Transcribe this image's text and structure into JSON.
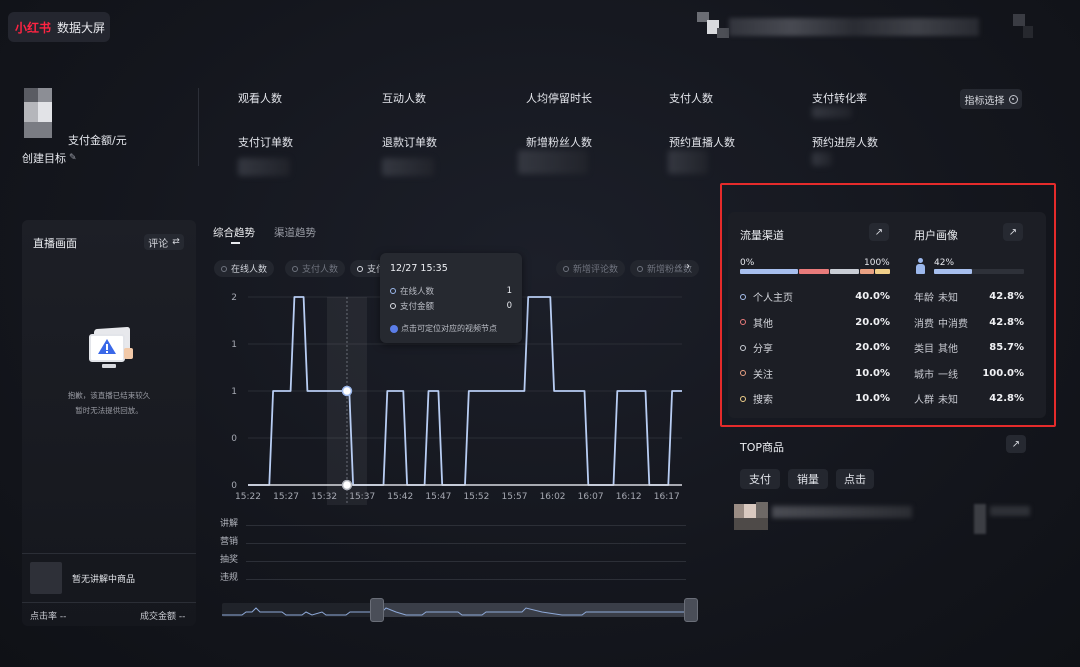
{
  "header": {
    "brand": "小红书",
    "title": "数据大屏"
  },
  "target": {
    "label": "支付金额/元",
    "create_label": "创建目标",
    "edit_icon": "pencil-icon"
  },
  "metrics": {
    "row1": [
      "观看人数",
      "互动人数",
      "人均停留时长",
      "支付人数",
      "支付转化率"
    ],
    "row2": [
      "支付订单数",
      "退款订单数",
      "新增粉丝人数",
      "预约直播人数",
      "预约进房人数"
    ],
    "select_button": "指标选择"
  },
  "live": {
    "title": "直播画面",
    "comment_button": "评论",
    "empty_line1": "抱歉，该直播已结束较久",
    "empty_line2": "暂时无法提供回放。",
    "product_label": "暂无讲解中商品",
    "click_rate_label": "点击率 --",
    "deal_amount_label": "成交金额 --"
  },
  "trend": {
    "tabs": [
      "综合趋势",
      "渠道趋势"
    ],
    "active_tab": 0,
    "legend": [
      {
        "label": "在线人数",
        "active": true,
        "color": "#9cb8ec"
      },
      {
        "label": "支付人数",
        "active": false,
        "color": "#6f737e"
      },
      {
        "label": "支付金额",
        "active": true,
        "color": "#d9dbe2"
      },
      {
        "label": "新增评论数",
        "active": false,
        "color": "#6f737e"
      },
      {
        "label": "新增粉丝数",
        "active": false,
        "color": "#6f737e"
      }
    ],
    "tooltip": {
      "time": "12/27 15:35",
      "rows": [
        {
          "label": "在线人数",
          "value": "1"
        },
        {
          "label": "支付金额",
          "value": "0"
        }
      ],
      "hint": "点击可定位对应的视频节点"
    },
    "lanes": [
      "讲解",
      "营销",
      "抽奖",
      "违规"
    ]
  },
  "chart_data": {
    "type": "line",
    "ylabels": [
      "0",
      "0",
      "1",
      "1",
      "2"
    ],
    "x_ticks": [
      "15:22",
      "15:27",
      "15:32",
      "15:37",
      "15:42",
      "15:47",
      "15:52",
      "15:57",
      "16:02",
      "16:07",
      "16:12",
      "16:17"
    ],
    "x_range_minutes": [
      0,
      57
    ],
    "ylim": [
      0,
      2
    ],
    "series": [
      {
        "name": "在线人数",
        "color": "#b8cdf3",
        "points": [
          [
            0,
            0
          ],
          [
            2.8,
            0
          ],
          [
            3.3,
            1
          ],
          [
            5.6,
            1
          ],
          [
            6.1,
            2
          ],
          [
            7.3,
            2
          ],
          [
            7.8,
            1
          ],
          [
            13.3,
            1
          ],
          [
            13.8,
            0
          ],
          [
            17.8,
            0
          ],
          [
            18.3,
            1
          ],
          [
            20.4,
            1
          ],
          [
            20.9,
            0
          ],
          [
            23.2,
            0
          ],
          [
            23.7,
            1
          ],
          [
            25.0,
            1
          ],
          [
            25.5,
            0
          ],
          [
            28.5,
            0
          ],
          [
            29.0,
            1
          ],
          [
            36.3,
            1
          ],
          [
            36.8,
            2
          ],
          [
            39.7,
            2
          ],
          [
            40.2,
            1
          ],
          [
            44.2,
            1
          ],
          [
            44.7,
            0
          ],
          [
            48.0,
            0
          ],
          [
            48.5,
            1
          ],
          [
            52.2,
            1
          ],
          [
            52.7,
            0
          ],
          [
            55.2,
            0
          ],
          [
            55.7,
            1
          ],
          [
            57,
            1
          ]
        ]
      },
      {
        "name": "支付金额",
        "color": "#d9dbe2",
        "points": [
          [
            0,
            0
          ],
          [
            57,
            0
          ]
        ]
      }
    ],
    "cursor_minute": 13.0
  },
  "traffic": {
    "title": "流量渠道",
    "scale_min": "0%",
    "scale_max": "100%",
    "bar_segments": [
      {
        "fraction": 0.4,
        "color": "#a7bfee"
      },
      {
        "fraction": 0.2,
        "color": "#e97b7b"
      },
      {
        "fraction": 0.2,
        "color": "#c9cdd5"
      },
      {
        "fraction": 0.1,
        "color": "#e9a183"
      },
      {
        "fraction": 0.1,
        "color": "#f1d08a"
      }
    ],
    "rows": [
      {
        "label": "个人主页",
        "value": "40.0%",
        "color": "#a7bfee"
      },
      {
        "label": "其他",
        "value": "20.0%",
        "color": "#e97b7b"
      },
      {
        "label": "分享",
        "value": "20.0%",
        "color": "#c9cdd5"
      },
      {
        "label": "关注",
        "value": "10.0%",
        "color": "#e9a183"
      },
      {
        "label": "搜索",
        "value": "10.0%",
        "color": "#f1d08a"
      }
    ]
  },
  "persona": {
    "title": "用户画像",
    "gender_value": "42%",
    "gender_fraction": 0.42,
    "rows": [
      {
        "key": "年龄",
        "value": "未知",
        "pct": "42.8%"
      },
      {
        "key": "消费",
        "value": "中消费",
        "pct": "42.8%"
      },
      {
        "key": "类目",
        "value": "其他",
        "pct": "85.7%"
      },
      {
        "key": "城市",
        "value": "一线",
        "pct": "100.0%"
      },
      {
        "key": "人群",
        "value": "未知",
        "pct": "42.8%"
      }
    ]
  },
  "top_products": {
    "title": "TOP商品",
    "chips": [
      "支付",
      "销量",
      "点击"
    ]
  },
  "icons": {
    "expand": "external-arrow-icon",
    "swap": "swap-icon",
    "chevron": "chevron-icon"
  }
}
